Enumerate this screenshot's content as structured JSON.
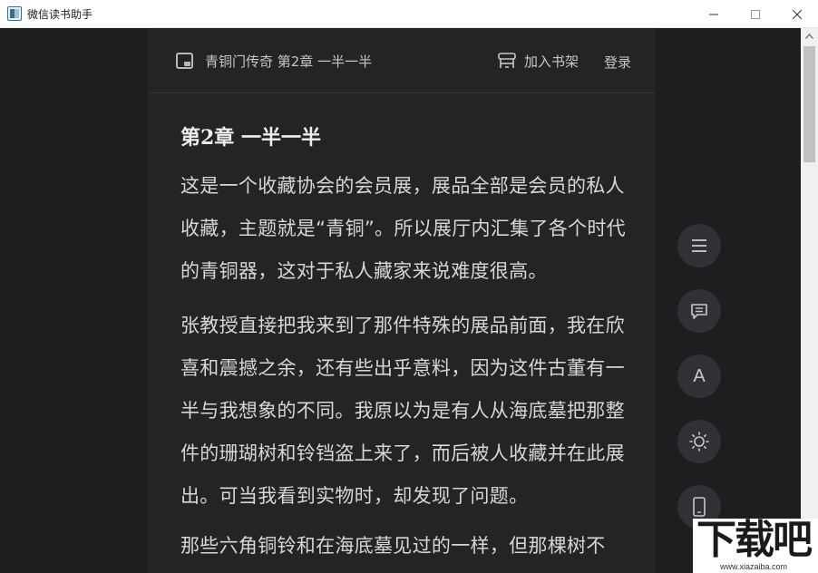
{
  "window": {
    "title": "微信读书助手"
  },
  "header": {
    "book_title": "青铜门传奇 第2章 一半一半",
    "shelf_label": "加入书架",
    "login_label": "登录"
  },
  "chapter": {
    "title": "第2章 一半一半",
    "paragraphs": [
      "这是一个收藏协会的会员展，展品全部是会员的私人收藏，主题就是“青铜”。所以展厅内汇集了各个时代的青铜器，这对于私人藏家来说难度很高。",
      "张教授直接把我来到了那件特殊的展品前面，我在欣喜和震撼之余，还有些出乎意料，因为这件古董有一半与我想象的不同。我原以为是有人从海底墓把那整件的珊瑚树和铃铛盗上来了，而后被人收藏并在此展出。可当我看到实物时，却发现了问题。",
      "那些六角铜铃和在海底墓见过的一样，但那棵树不"
    ]
  },
  "side_buttons": {
    "menu_icon": "menu-icon",
    "comment_icon": "comment-icon",
    "font_label": "A",
    "brightness_icon": "brightness-icon",
    "phone_icon": "phone-icon"
  },
  "watermark": {
    "main": "下载吧",
    "sub": "www.xiazaiba.com"
  },
  "colors": {
    "background": "#1c1d1f",
    "reader": "#232426",
    "text": "#d6d7d9",
    "fab": "#303134"
  }
}
